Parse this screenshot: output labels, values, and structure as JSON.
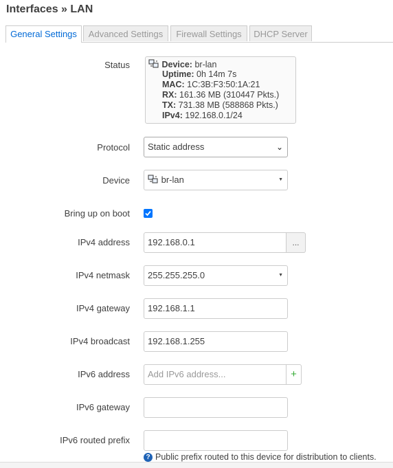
{
  "page": {
    "title": "Interfaces » LAN"
  },
  "tabs": [
    {
      "label": "General Settings",
      "active": true
    },
    {
      "label": "Advanced Settings",
      "active": false
    },
    {
      "label": "Firewall Settings",
      "active": false
    },
    {
      "label": "DHCP Server",
      "active": false
    }
  ],
  "status": {
    "label": "Status",
    "device_key": "Device:",
    "device_val": "br-lan",
    "uptime_key": "Uptime:",
    "uptime_val": "0h 14m 7s",
    "mac_key": "MAC:",
    "mac_val": "1C:3B:F3:50:1A:21",
    "rx_key": "RX:",
    "rx_val": "161.36 MB (310447 Pkts.)",
    "tx_key": "TX:",
    "tx_val": "731.38 MB (588868 Pkts.)",
    "ipv4_key": "IPv4:",
    "ipv4_val": "192.168.0.1/24"
  },
  "protocol": {
    "label": "Protocol",
    "value": "Static address"
  },
  "device": {
    "label": "Device",
    "value": "br-lan"
  },
  "boot": {
    "label": "Bring up on boot",
    "checked": true
  },
  "ipv4_address": {
    "label": "IPv4 address",
    "value": "192.168.0.1",
    "button": "..."
  },
  "ipv4_netmask": {
    "label": "IPv4 netmask",
    "value": "255.255.255.0"
  },
  "ipv4_gateway": {
    "label": "IPv4 gateway",
    "value": "192.168.1.1"
  },
  "ipv4_broadcast": {
    "label": "IPv4 broadcast",
    "value": "192.168.1.255"
  },
  "ipv6_address": {
    "label": "IPv6 address",
    "placeholder": "Add IPv6 address...",
    "button": "+"
  },
  "ipv6_gateway": {
    "label": "IPv6 gateway",
    "value": ""
  },
  "ipv6_prefix": {
    "label": "IPv6 routed prefix",
    "value": "",
    "hint": "Public prefix routed to this device for distribution to clients.",
    "hint_icon": "?"
  },
  "colors": {
    "accent": "#0069d6",
    "checkbox": "#0075ff",
    "help": "#1f63b6"
  }
}
